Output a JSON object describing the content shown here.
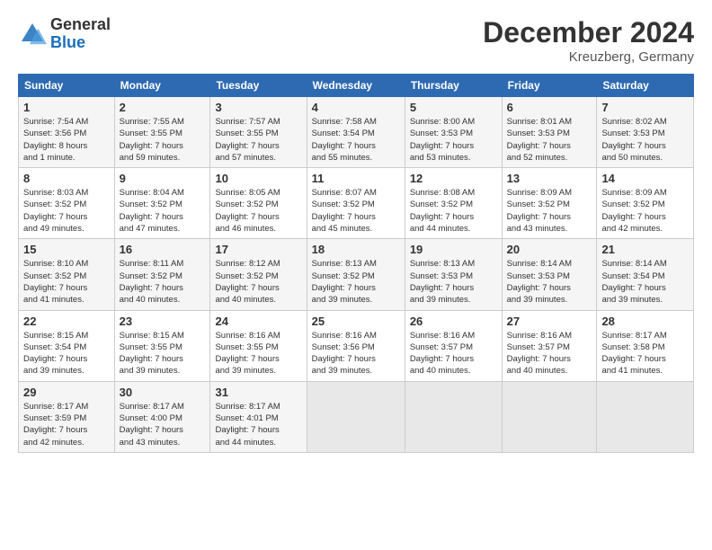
{
  "header": {
    "logo_line1": "General",
    "logo_line2": "Blue",
    "month": "December 2024",
    "location": "Kreuzberg, Germany"
  },
  "days_of_week": [
    "Sunday",
    "Monday",
    "Tuesday",
    "Wednesday",
    "Thursday",
    "Friday",
    "Saturday"
  ],
  "weeks": [
    [
      {
        "day": "1",
        "info": "Sunrise: 7:54 AM\nSunset: 3:56 PM\nDaylight: 8 hours\nand 1 minute."
      },
      {
        "day": "2",
        "info": "Sunrise: 7:55 AM\nSunset: 3:55 PM\nDaylight: 7 hours\nand 59 minutes."
      },
      {
        "day": "3",
        "info": "Sunrise: 7:57 AM\nSunset: 3:55 PM\nDaylight: 7 hours\nand 57 minutes."
      },
      {
        "day": "4",
        "info": "Sunrise: 7:58 AM\nSunset: 3:54 PM\nDaylight: 7 hours\nand 55 minutes."
      },
      {
        "day": "5",
        "info": "Sunrise: 8:00 AM\nSunset: 3:53 PM\nDaylight: 7 hours\nand 53 minutes."
      },
      {
        "day": "6",
        "info": "Sunrise: 8:01 AM\nSunset: 3:53 PM\nDaylight: 7 hours\nand 52 minutes."
      },
      {
        "day": "7",
        "info": "Sunrise: 8:02 AM\nSunset: 3:53 PM\nDaylight: 7 hours\nand 50 minutes."
      }
    ],
    [
      {
        "day": "8",
        "info": "Sunrise: 8:03 AM\nSunset: 3:52 PM\nDaylight: 7 hours\nand 49 minutes."
      },
      {
        "day": "9",
        "info": "Sunrise: 8:04 AM\nSunset: 3:52 PM\nDaylight: 7 hours\nand 47 minutes."
      },
      {
        "day": "10",
        "info": "Sunrise: 8:05 AM\nSunset: 3:52 PM\nDaylight: 7 hours\nand 46 minutes."
      },
      {
        "day": "11",
        "info": "Sunrise: 8:07 AM\nSunset: 3:52 PM\nDaylight: 7 hours\nand 45 minutes."
      },
      {
        "day": "12",
        "info": "Sunrise: 8:08 AM\nSunset: 3:52 PM\nDaylight: 7 hours\nand 44 minutes."
      },
      {
        "day": "13",
        "info": "Sunrise: 8:09 AM\nSunset: 3:52 PM\nDaylight: 7 hours\nand 43 minutes."
      },
      {
        "day": "14",
        "info": "Sunrise: 8:09 AM\nSunset: 3:52 PM\nDaylight: 7 hours\nand 42 minutes."
      }
    ],
    [
      {
        "day": "15",
        "info": "Sunrise: 8:10 AM\nSunset: 3:52 PM\nDaylight: 7 hours\nand 41 minutes."
      },
      {
        "day": "16",
        "info": "Sunrise: 8:11 AM\nSunset: 3:52 PM\nDaylight: 7 hours\nand 40 minutes."
      },
      {
        "day": "17",
        "info": "Sunrise: 8:12 AM\nSunset: 3:52 PM\nDaylight: 7 hours\nand 40 minutes."
      },
      {
        "day": "18",
        "info": "Sunrise: 8:13 AM\nSunset: 3:52 PM\nDaylight: 7 hours\nand 39 minutes."
      },
      {
        "day": "19",
        "info": "Sunrise: 8:13 AM\nSunset: 3:53 PM\nDaylight: 7 hours\nand 39 minutes."
      },
      {
        "day": "20",
        "info": "Sunrise: 8:14 AM\nSunset: 3:53 PM\nDaylight: 7 hours\nand 39 minutes."
      },
      {
        "day": "21",
        "info": "Sunrise: 8:14 AM\nSunset: 3:54 PM\nDaylight: 7 hours\nand 39 minutes."
      }
    ],
    [
      {
        "day": "22",
        "info": "Sunrise: 8:15 AM\nSunset: 3:54 PM\nDaylight: 7 hours\nand 39 minutes."
      },
      {
        "day": "23",
        "info": "Sunrise: 8:15 AM\nSunset: 3:55 PM\nDaylight: 7 hours\nand 39 minutes."
      },
      {
        "day": "24",
        "info": "Sunrise: 8:16 AM\nSunset: 3:55 PM\nDaylight: 7 hours\nand 39 minutes."
      },
      {
        "day": "25",
        "info": "Sunrise: 8:16 AM\nSunset: 3:56 PM\nDaylight: 7 hours\nand 39 minutes."
      },
      {
        "day": "26",
        "info": "Sunrise: 8:16 AM\nSunset: 3:57 PM\nDaylight: 7 hours\nand 40 minutes."
      },
      {
        "day": "27",
        "info": "Sunrise: 8:16 AM\nSunset: 3:57 PM\nDaylight: 7 hours\nand 40 minutes."
      },
      {
        "day": "28",
        "info": "Sunrise: 8:17 AM\nSunset: 3:58 PM\nDaylight: 7 hours\nand 41 minutes."
      }
    ],
    [
      {
        "day": "29",
        "info": "Sunrise: 8:17 AM\nSunset: 3:59 PM\nDaylight: 7 hours\nand 42 minutes."
      },
      {
        "day": "30",
        "info": "Sunrise: 8:17 AM\nSunset: 4:00 PM\nDaylight: 7 hours\nand 43 minutes."
      },
      {
        "day": "31",
        "info": "Sunrise: 8:17 AM\nSunset: 4:01 PM\nDaylight: 7 hours\nand 44 minutes."
      },
      {
        "day": "",
        "info": ""
      },
      {
        "day": "",
        "info": ""
      },
      {
        "day": "",
        "info": ""
      },
      {
        "day": "",
        "info": ""
      }
    ]
  ]
}
